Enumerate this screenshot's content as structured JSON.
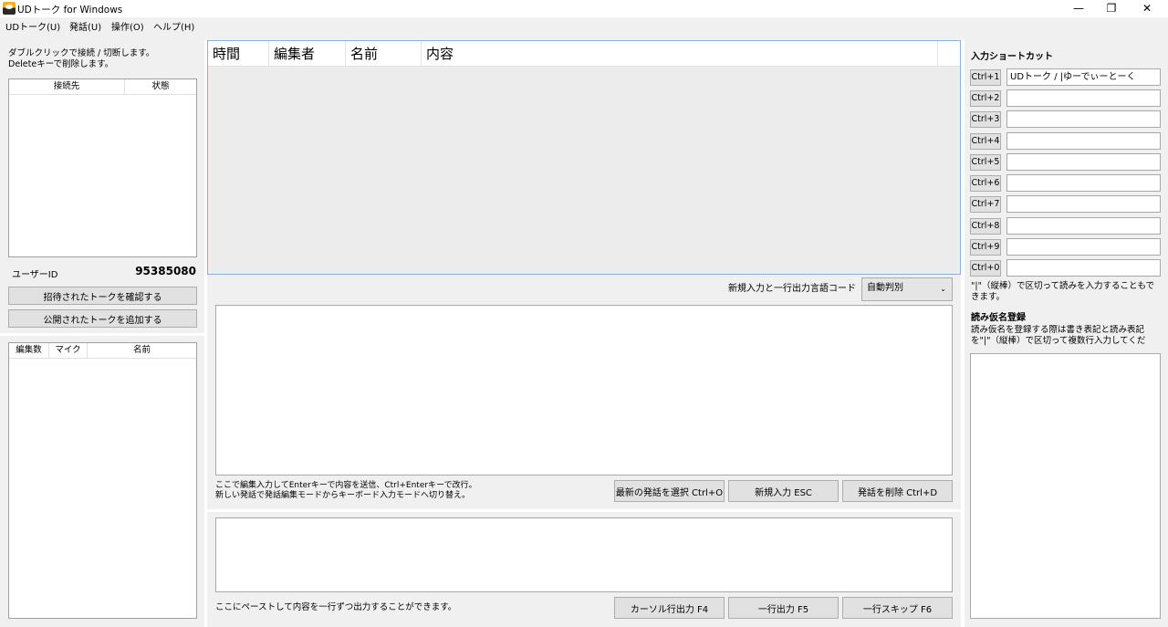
{
  "window": {
    "title": "UDトーク for Windows",
    "minimize_glyph": "—",
    "restore_glyph": "❐",
    "close_glyph": "✕"
  },
  "menu": [
    "UDトーク(U)",
    "発話(U)",
    "操作(O)",
    "ヘルプ(H)"
  ],
  "left": {
    "hint": "ダブルクリックで接続 / 切断します。\nDeleteキーで削除します。",
    "connections": {
      "columns": [
        "接続先",
        "状態"
      ]
    },
    "user_id_label": "ユーザーID",
    "user_id_value": "95385080",
    "check_invited_button": "招待されたトークを確認する",
    "add_public_button": "公開されたトークを追加する",
    "editors": {
      "columns": [
        "編集数",
        "マイク",
        "名前"
      ]
    }
  },
  "center": {
    "grid_columns": [
      "時間",
      "編集者",
      "名前",
      "内容"
    ],
    "language_label": "新規入力と一行出力言語コード",
    "language_value": "自動判別",
    "combo_arrow": "⌄",
    "edit_hint": "ここで編集入力してEnterキーで内容を送信、Ctrl+Enterキーで改行。\n新しい発話で発話編集モードからキーボード入力モードへ切り替え。",
    "select_latest_button": "最新の発話を選択 Ctrl+O",
    "new_input_button": "新規入力 ESC",
    "delete_utterance_button": "発話を削除 Ctrl+D",
    "paste_hint": "ここにペーストして内容を一行ずつ出力することができます。",
    "cursor_output_button": "カーソル行出力 F4",
    "line_output_button": "一行出力 F5",
    "line_skip_button": "一行スキップ F6"
  },
  "right": {
    "shortcuts_title": "入力ショートカット",
    "shortcuts": [
      {
        "key": "Ctrl+1",
        "value": "UDトーク / |ゆーでぃーとーく"
      },
      {
        "key": "Ctrl+2",
        "value": ""
      },
      {
        "key": "Ctrl+3",
        "value": ""
      },
      {
        "key": "Ctrl+4",
        "value": ""
      },
      {
        "key": "Ctrl+5",
        "value": ""
      },
      {
        "key": "Ctrl+6",
        "value": ""
      },
      {
        "key": "Ctrl+7",
        "value": ""
      },
      {
        "key": "Ctrl+8",
        "value": ""
      },
      {
        "key": "Ctrl+9",
        "value": ""
      },
      {
        "key": "Ctrl+0",
        "value": ""
      }
    ],
    "shortcut_note": "\"|\"（縦棒）で区切って読みを入力することもできます。",
    "reading_title": "読み仮名登録",
    "reading_note": "読み仮名を登録する際は書き表記と読み表記を\"|\"（縦棒）で区切って複数行入力してくだ"
  }
}
